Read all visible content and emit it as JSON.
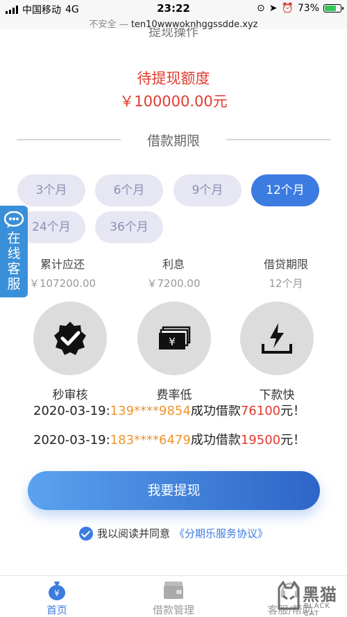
{
  "status_bar": {
    "carrier": "中国移动",
    "network": "4G",
    "time": "23:22",
    "battery": "73%",
    "battery_level": 0.73
  },
  "url_bar": {
    "insecure_label": "不安全 —",
    "host": "ten10wwwoknhggssdde.xyz"
  },
  "section_top": {
    "title": "提现操作"
  },
  "withdraw": {
    "label": "待提现额度",
    "amount": "￥100000.00元"
  },
  "loan_term": {
    "title": "借款期限",
    "options": [
      "3个月",
      "6个月",
      "9个月",
      "12个月",
      "24个月",
      "36个月"
    ],
    "selected": "12个月"
  },
  "side_service": {
    "text": "在线客服"
  },
  "summary": [
    {
      "label": "累计应还",
      "value": "￥107200.00"
    },
    {
      "label": "利息",
      "value": "￥7200.00"
    },
    {
      "label": "借贷期限",
      "value": "12个月"
    }
  ],
  "features": [
    {
      "label": "秒审核",
      "icon": "verified-badge-icon"
    },
    {
      "label": "费率低",
      "icon": "money-stack-icon"
    },
    {
      "label": "下款快",
      "icon": "lightning-download-icon"
    }
  ],
  "ticker": [
    {
      "date": "2020-03-19:",
      "phone": "139****9854",
      "mid": "成功借款",
      "amount": "76100",
      "unit": "元！"
    },
    {
      "date": "2020-03-19:",
      "phone": "183****6479",
      "mid": "成功借款",
      "amount": "19500",
      "unit": "元！"
    }
  ],
  "cta": {
    "label": "我要提现"
  },
  "agreement": {
    "prefix": "我以阅读并同意",
    "link": "《分期乐服务协议》"
  },
  "tabbar": [
    {
      "label": "首页",
      "active": true
    },
    {
      "label": "借款管理",
      "active": false
    },
    {
      "label": "客服/帮助",
      "active": false
    }
  ],
  "watermark": {
    "cn": "黑猫",
    "en": "BLACK CAT"
  },
  "colors": {
    "accent": "#3c7be0",
    "red": "#e23a2e",
    "orange": "#f0932b"
  }
}
